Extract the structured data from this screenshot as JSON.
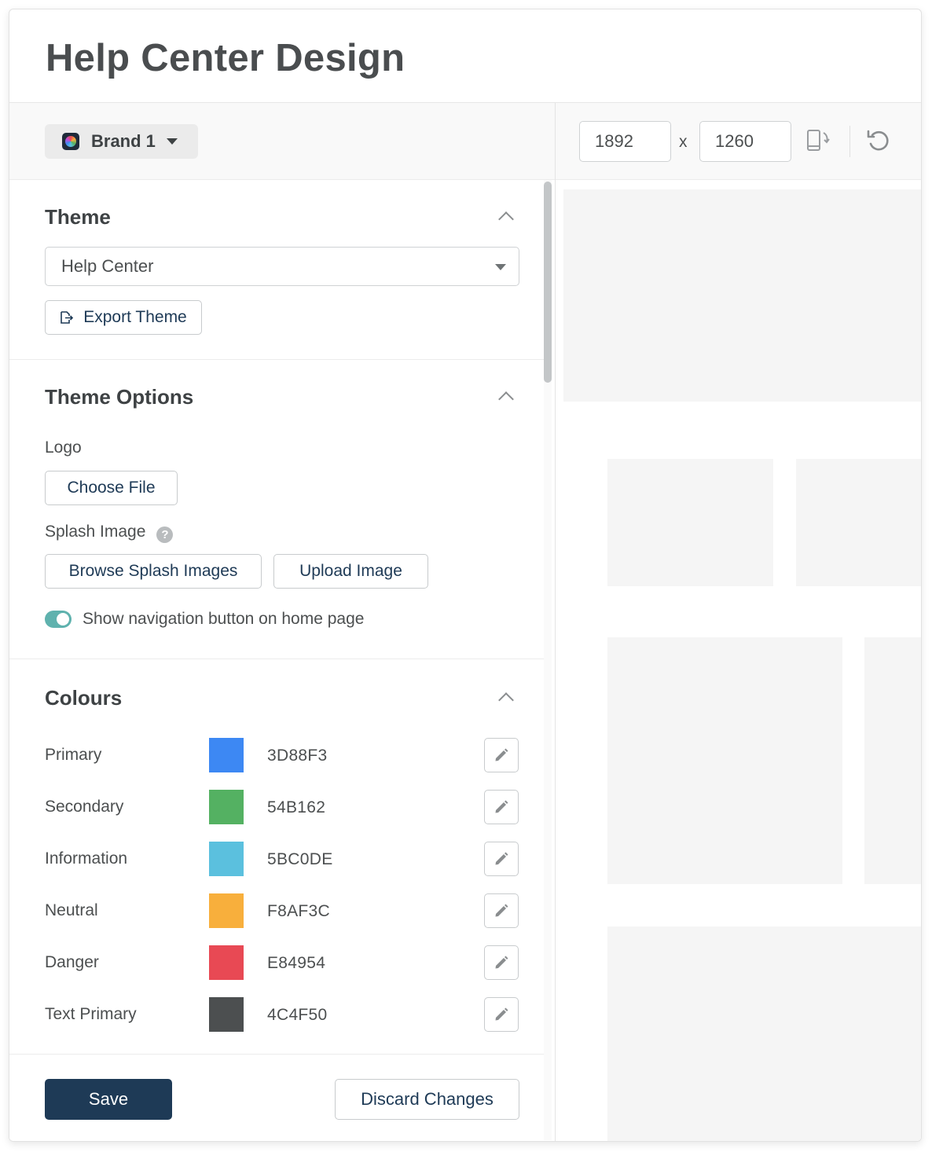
{
  "page": {
    "title": "Help Center Design"
  },
  "brand": {
    "label": "Brand 1",
    "icon": "brand-logo-icon"
  },
  "theme_section": {
    "title": "Theme",
    "selected_theme": "Help Center",
    "export_label": "Export Theme"
  },
  "options_section": {
    "title": "Theme Options",
    "logo_label": "Logo",
    "choose_file_label": "Choose File",
    "splash_label": "Splash Image",
    "help_glyph": "?",
    "browse_label": "Browse Splash Images",
    "upload_label": "Upload Image",
    "toggle_label": "Show navigation button on home page",
    "toggle_on": true
  },
  "colours_section": {
    "title": "Colours",
    "rows": [
      {
        "name": "Primary",
        "hex": "3D88F3",
        "color": "#3D88F3"
      },
      {
        "name": "Secondary",
        "hex": "54B162",
        "color": "#54B162"
      },
      {
        "name": "Information",
        "hex": "5BC0DE",
        "color": "#5BC0DE"
      },
      {
        "name": "Neutral",
        "hex": "F8AF3C",
        "color": "#F8AF3C"
      },
      {
        "name": "Danger",
        "hex": "E84954",
        "color": "#E84954"
      },
      {
        "name": "Text Primary",
        "hex": "4C4F50",
        "color": "#4C4F50"
      }
    ]
  },
  "footer": {
    "save_label": "Save",
    "discard_label": "Discard Changes"
  },
  "preview": {
    "width_value": "1892",
    "times_label": "x",
    "height_value": "1260",
    "rotate_icon": "rotate-device-icon",
    "reset_icon": "reset-icon"
  },
  "theme_colors": {
    "primary_button": "#1E3A56",
    "toggle": "#5FB2AE"
  }
}
